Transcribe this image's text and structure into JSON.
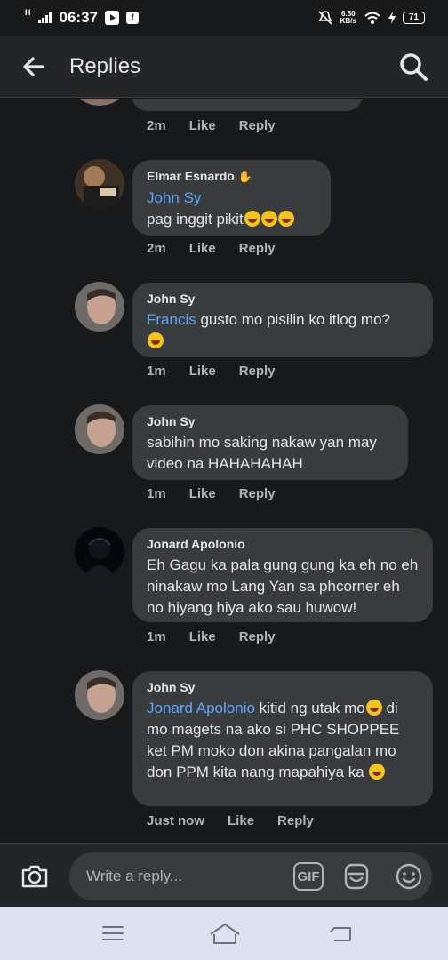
{
  "status_bar": {
    "network": "H",
    "time": "06:37",
    "speed_value": "6.50",
    "speed_unit": "KB/s",
    "battery": "71"
  },
  "appbar": {
    "title": "Replies",
    "back_icon": "arrow-left-icon",
    "search_icon": "search-icon"
  },
  "partial_comment": {
    "time": "2m",
    "like": "Like",
    "reply": "Reply"
  },
  "comments": [
    {
      "name": "Elmar Esnardo",
      "name_badge": "waving-hand-icon",
      "mention": "John Sy",
      "text": "pag inggit pikit",
      "emojis": 3,
      "time": "2m",
      "like": "Like",
      "reply": "Reply"
    },
    {
      "name": "John Sy",
      "mention": "Francis",
      "text": " gusto mo pisilin ko itlog mo?",
      "emojis": 1,
      "time": "1m",
      "like": "Like",
      "reply": "Reply"
    },
    {
      "name": "John Sy",
      "text": "sabihin mo saking nakaw yan may video na HAHAHAHAH",
      "time": "1m",
      "like": "Like",
      "reply": "Reply"
    },
    {
      "name": "Jonard Apolonio",
      "text": "Eh Gagu ka pala gung gung ka eh no eh ninakaw mo Lang Yan sa phcorner eh no hiyang hiya ako sau huwow!",
      "time": "1m",
      "like": "Like",
      "reply": "Reply"
    },
    {
      "name": "John Sy",
      "mention": "Jonard Apolonio",
      "text_after_mention": " kitid ng utak mo",
      "text_rest": "di mo magets na ako si PHC SHOPPEE ket PM moko don akina pangalan mo don PPM kita nang mapahiya ka ",
      "time": "Just now",
      "like": "Like",
      "reply": "Reply"
    }
  ],
  "composer": {
    "camera_icon": "camera-icon",
    "placeholder": "Write a reply...",
    "gif_label": "GIF",
    "sticker_icon": "sticker-icon",
    "emoji_icon": "smiley-icon"
  },
  "nav": {
    "menu_icon": "menu-icon",
    "home_icon": "home-icon",
    "back_icon": "back-icon"
  },
  "colors": {
    "background": "#18191a",
    "bubble": "#3a3b3c",
    "mention": "#5aa7ff",
    "secondary_text": "#b0b3b8"
  }
}
